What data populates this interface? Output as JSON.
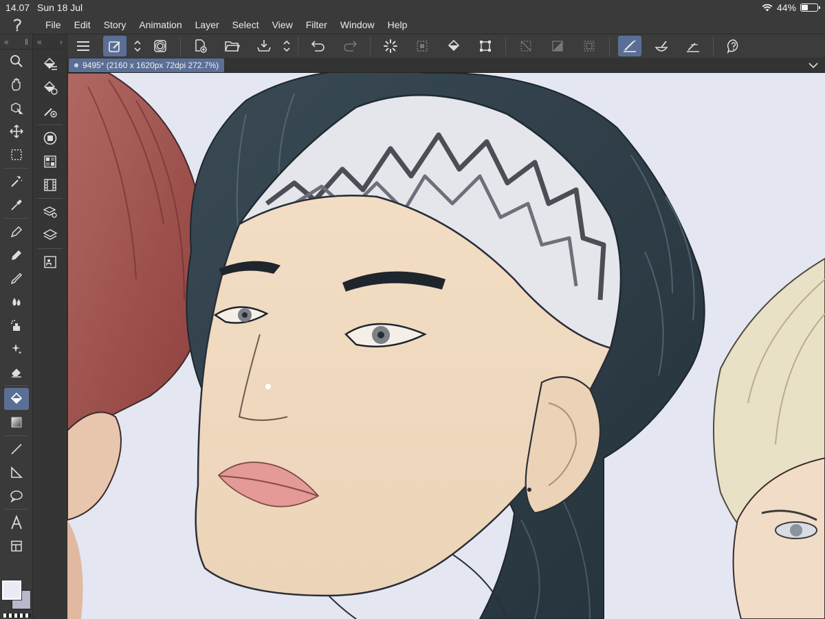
{
  "status": {
    "time": "14.07",
    "date": "Sun 18 Jul",
    "battery": "44%",
    "battery_level": 0.44
  },
  "menubar": {
    "items": [
      "File",
      "Edit",
      "Story",
      "Animation",
      "Layer",
      "Select",
      "View",
      "Filter",
      "Window",
      "Help"
    ]
  },
  "tab": {
    "title": "9495* (2160 x 1620px 72dpi 272.7%)"
  },
  "colors": {
    "accent": "#5b6f96",
    "main_color": "#e9ecf7",
    "sub_color": "#b9b7cc",
    "canvas_bg": "#e4e6f1"
  },
  "toolbar_icons": [
    "menu-icon",
    "pen-settings-icon",
    "spinner-icon",
    "lasso-icon",
    "new-canvas-icon",
    "open-folder-icon",
    "save-icon",
    "undo-icon",
    "redo-icon",
    "loading-icon",
    "deselect-icon",
    "fill-icon",
    "transform-icon",
    "hide-selection-icon",
    "clear-icon",
    "select-frame-icon",
    "ruler-snap-icon",
    "brush-icon",
    "perspective-snap-icon",
    "help-icon"
  ],
  "tools": [
    "zoom-icon",
    "hand-icon",
    "object-icon",
    "move-icon",
    "selection-icon",
    "magic-wand-icon",
    "eyedropper-icon",
    "pen-icon",
    "pencil-icon",
    "brush-icon",
    "blend-icon",
    "airbrush-icon",
    "decoration-icon",
    "eraser-icon",
    "fill-icon",
    "gradient-icon",
    "line-icon",
    "frame-icon",
    "balloon-icon",
    "text-icon",
    "correct-line-icon"
  ]
}
